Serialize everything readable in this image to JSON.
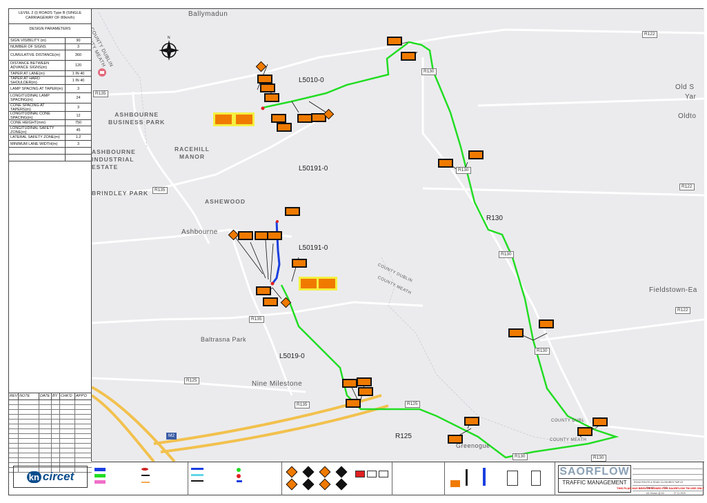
{
  "design": {
    "header": "LEVEL 2 (i) ROADS Type B (SINGLE CARRIAGEWAY OF 80km/h)",
    "subheader": "DESIGN PARAMETERS",
    "params": [
      {
        "label": "SIGN VISIBILITY (m)",
        "value": "90"
      },
      {
        "label": "NUMBER OF SIGNS",
        "value": "3"
      },
      {
        "label": "CUMULATIVE DISTANCE(m)",
        "value": "360"
      },
      {
        "label": "DISTANCE BETWEEN ADVANCE SIGNS(m)",
        "value": "120"
      },
      {
        "label": "TAPER AT LANE(m)",
        "value": "1 IN 40"
      },
      {
        "label": "TAPER AT HARD SHOULDER(m)",
        "value": "1 IN 40"
      },
      {
        "label": "LAMP SPACING AT TAPER(m)",
        "value": "3"
      },
      {
        "label": "LONGITUDINAL LAMP SPACING(m)",
        "value": "24"
      },
      {
        "label": "CONE SPACING AT TAPERS(m)",
        "value": "3"
      },
      {
        "label": "LONGITUDINAL CONE SPACING(m)",
        "value": "12"
      },
      {
        "label": "CONE HEIGHT(mm)",
        "value": "750"
      },
      {
        "label": "LONGITUDINAL SAFETY ZONE(m)",
        "value": "45"
      },
      {
        "label": "LATERAL SAFETY ZONE(m)",
        "value": "1.2"
      },
      {
        "label": "MINIMUM LANE WIDTH(m)",
        "value": "3"
      }
    ]
  },
  "revision": {
    "columns": [
      "REV",
      "NOTE",
      "DATE",
      "BY",
      "CHK'D",
      "APP'D"
    ]
  },
  "logo": {
    "kn": "kn",
    "brand": "circet"
  },
  "map": {
    "places": {
      "ballymadun": "Ballymadun",
      "county_dublin_top": "COUNTY DUBLIN",
      "county_meath_top": "COUNTY MEATH",
      "ashbourne_bp": "ASHBOURNE\nBUSINESS PARK",
      "ashbourne_ie": "ASHBOURNE\nINDUSTRIAL\nESTATE",
      "racehill": "RACEHILL\nMANOR",
      "brindley": "BRINDLEY PARK",
      "ashewood": "ASHEWOOD",
      "ashbourne": "Ashbourne",
      "baltrasna": "Baltrasna Park",
      "nine_milestone": "Nine Milestone",
      "county_dublin_mid": "COUNTY DUBLIN",
      "county_meath_mid": "COUNTY MEATH",
      "old_s": "Old S",
      "yar": "Yar",
      "oldto": "Oldto",
      "fieldstown": "Fieldstown-Ea",
      "greenogue": "Greenogue",
      "county_dublin_br": "COUNTY DUBL",
      "county_meath_br": "COUNTY MEATH"
    },
    "roads": {
      "l5010": "L5010-0",
      "l50191a": "L50191-0",
      "l50191b": "L50191-0",
      "r130": "R130",
      "l5019": "L5019-0",
      "r125": "R125"
    },
    "shields": [
      "R122",
      "R130",
      "R135",
      "R135",
      "R130",
      "R122",
      "R130",
      "R135",
      "R130",
      "R125",
      "R135",
      "R125",
      "R130",
      "R122",
      "M2",
      "R130"
    ],
    "route_colors": {
      "green": "#22dd22",
      "blue": "#1a3fe0",
      "motorway": "#f2c14e"
    }
  },
  "legend": {
    "company": "SAORFLOW",
    "company_sub": "TRAFFIC MANAGEMENT",
    "plan_title": "ROAD ROUTE & ROAD CLOSURES TMP-02",
    "rev": "Rev 02",
    "checked": "DC",
    "scale": "A4-Shown @ A3",
    "date": "27.11.2020",
    "warning": "THIS PLAN HAS BEEN DESIGNED FOR SAORFLOW TM USE ONLY"
  }
}
